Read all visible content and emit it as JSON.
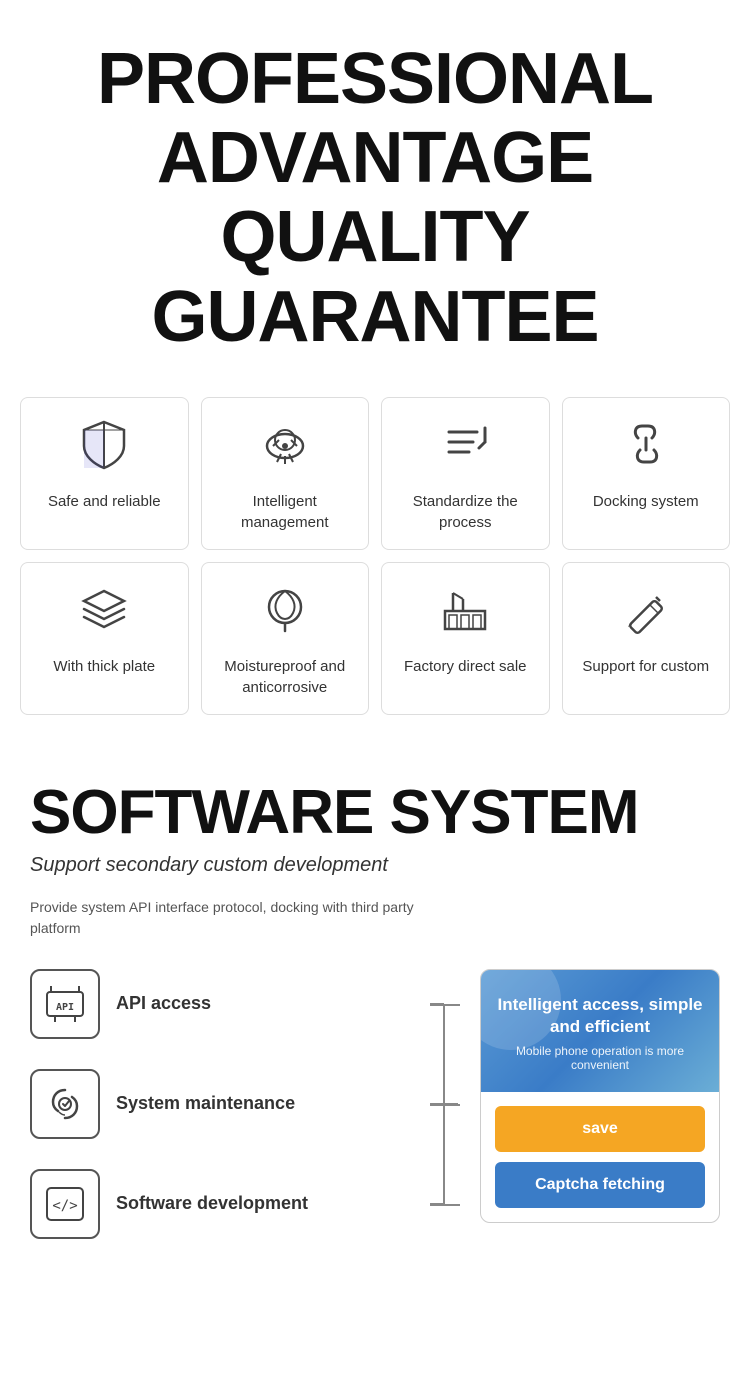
{
  "header": {
    "line1": "PROFESSIONAL",
    "line2": "ADVANTAGE",
    "line3": "QUALITY GUARANTEE"
  },
  "features": {
    "row1": [
      {
        "id": "safe-reliable",
        "label": "Safe and\nreliable",
        "icon": "shield"
      },
      {
        "id": "intelligent-mgmt",
        "label": "Intelligent\nmanagement",
        "icon": "cloud"
      },
      {
        "id": "standardize",
        "label": "Standardize\nthe process",
        "icon": "task"
      },
      {
        "id": "docking",
        "label": "Docking\nsystem",
        "icon": "link"
      }
    ],
    "row2": [
      {
        "id": "thick-plate",
        "label": "With thick\nplate",
        "icon": "layers"
      },
      {
        "id": "moistureproof",
        "label": "Moistureproof\nand anticorrosive",
        "icon": "leaf"
      },
      {
        "id": "factory-direct",
        "label": "Factory\ndirect sale",
        "icon": "factory"
      },
      {
        "id": "support-custom",
        "label": "Support for\ncustom",
        "icon": "pencil"
      }
    ]
  },
  "software": {
    "title": "SOFTWARE SYSTEM",
    "subtitle": "Support secondary custom development",
    "description": "Provide system API interface protocol,\ndocking with third party platform",
    "items": [
      {
        "id": "api",
        "label": "API access",
        "icon": "api"
      },
      {
        "id": "maintenance",
        "label": "System\nmaintenance",
        "icon": "maintenance"
      },
      {
        "id": "dev",
        "label": "Software\ndevelopment",
        "icon": "code"
      }
    ],
    "panel": {
      "title": "Intelligent access,\nsimple and efficient",
      "subtitle": "Mobile phone operation is more\nconvenient",
      "save_label": "save",
      "captcha_label": "Captcha fetching"
    }
  }
}
